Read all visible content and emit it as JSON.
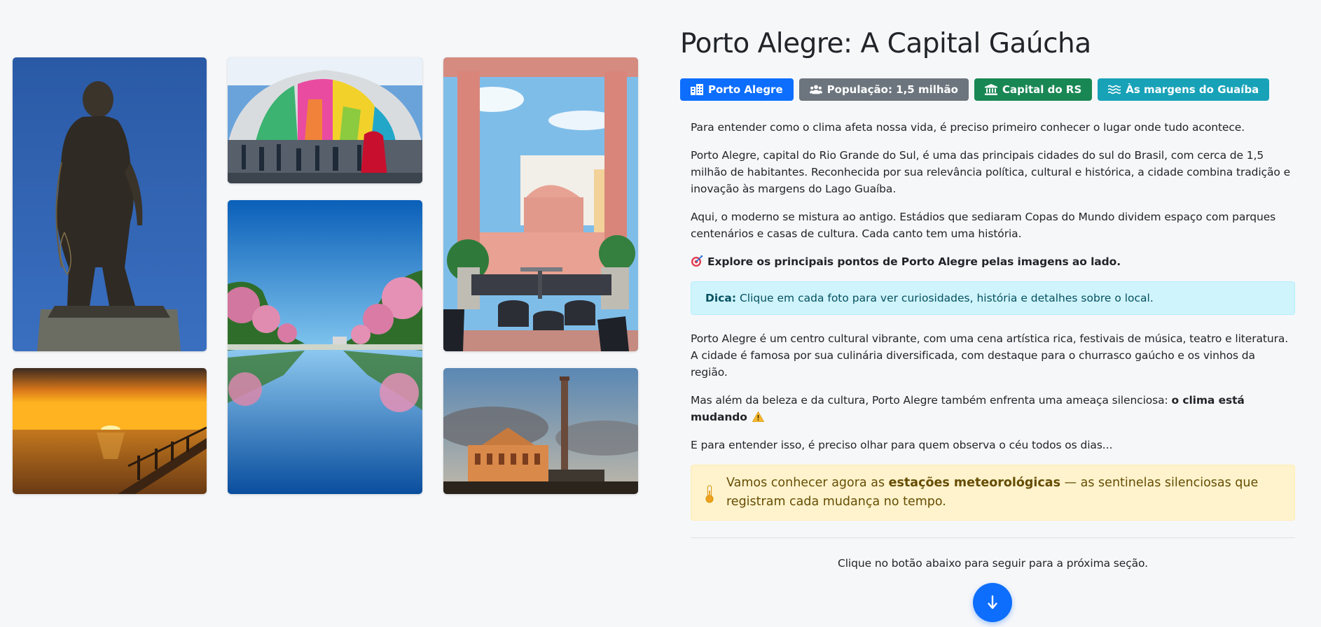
{
  "title": "Porto Alegre: A Capital Gaúcha",
  "badges": [
    {
      "label": "Porto Alegre",
      "icon": "city-icon",
      "color": "#0d6efd"
    },
    {
      "label": "População: 1,5 milhão",
      "icon": "users-icon",
      "color": "#6c757d"
    },
    {
      "label": "Capital do RS",
      "icon": "landmark-icon",
      "color": "#198754"
    },
    {
      "label": "Às margens do Guaíba",
      "icon": "water-icon",
      "color": "#17a2b8"
    }
  ],
  "paragraphs": {
    "p1": "Para entender como o clima afeta nossa vida, é preciso primeiro conhecer o lugar onde tudo acontece.",
    "p2": "Porto Alegre, capital do Rio Grande do Sul, é uma das principais cidades do sul do Brasil, com cerca de 1,5 milhão de habitantes. Reconhecida por sua relevância política, cultural e histórica, a cidade combina tradição e inovação às margens do Lago Guaíba.",
    "p3": "Aqui, o moderno se mistura ao antigo. Estádios que sediaram Copas do Mundo dividem espaço com parques centenários e casas de cultura. Cada canto tem uma história.",
    "explore": "Explore os principais pontos de Porto Alegre pelas imagens ao lado.",
    "p4": "Porto Alegre é um centro cultural vibrante, com uma cena artística rica, festivais de música, teatro e literatura. A cidade é famosa por sua culinária diversificada, com destaque para o churrasco gaúcho e os vinhos da região.",
    "p5_prefix": "Mas além da beleza e da cultura, Porto Alegre também enfrenta uma ameaça silenciosa: ",
    "p5_strong": "o clima está mudando",
    "p6": "E para entender isso, é preciso olhar para quem observa o céu todos os dias..."
  },
  "tip": {
    "label": "Dica:",
    "text": " Clique em cada foto para ver curiosidades, história e detalhes sobre o local."
  },
  "alert": {
    "prefix": "Vamos conhecer agora as ",
    "strong": "estações meteorológicas",
    "suffix": " — as sentinelas silenciosas que registram cada mudança no tempo."
  },
  "hint": "Clique no botão abaixo para seguir para a próxima seção.",
  "gallery": {
    "photos": [
      {
        "name": "statue-photo"
      },
      {
        "name": "stadium-photo"
      },
      {
        "name": "rooftop-terrace-photo"
      },
      {
        "name": "sunset-lake-photo"
      },
      {
        "name": "park-reflection-photo"
      },
      {
        "name": "chimney-building-photo"
      }
    ]
  },
  "colors": {
    "primary": "#0d6efd",
    "secondary": "#6c757d",
    "success": "#198754",
    "info": "#17a2b8",
    "tip_bg": "#cff4fc",
    "alert_bg": "#fff3cd"
  }
}
